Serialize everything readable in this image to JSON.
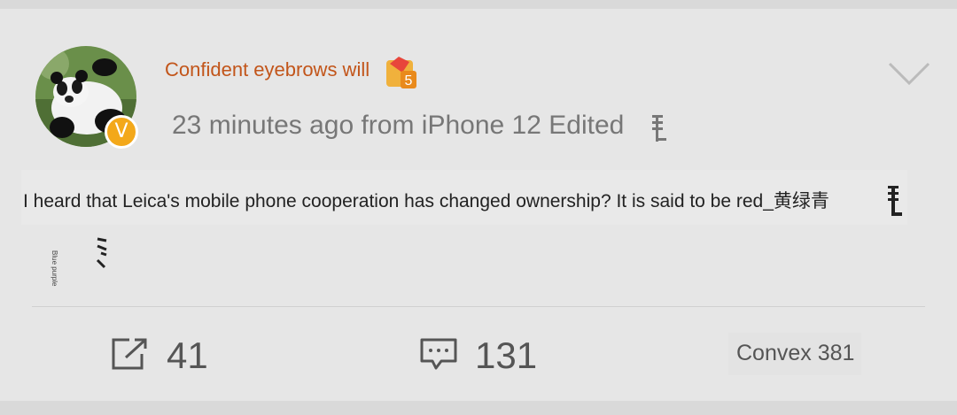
{
  "post": {
    "username": "Confident eyebrows will",
    "level": "5",
    "verified_mark": "V",
    "meta": "23 minutes ago from iPhone 12 Edited",
    "text": "I heard that Leica's mobile phone cooperation has changed ownership? It is said to be red_黄绿青",
    "tiny_label": "Blue purple"
  },
  "actions": {
    "repost_count": "41",
    "comment_count": "131",
    "like_label": "Convex 381"
  },
  "icons": {
    "avatar": "panda-avatar",
    "badge": "verified-badge",
    "level": "level-badge-icon",
    "menu": "chevron-down-icon",
    "repost": "share-icon",
    "comment": "comment-icon"
  },
  "colors": {
    "username": "#c2551a",
    "verified": "#f3a81a",
    "background": "#e6e6e6"
  }
}
